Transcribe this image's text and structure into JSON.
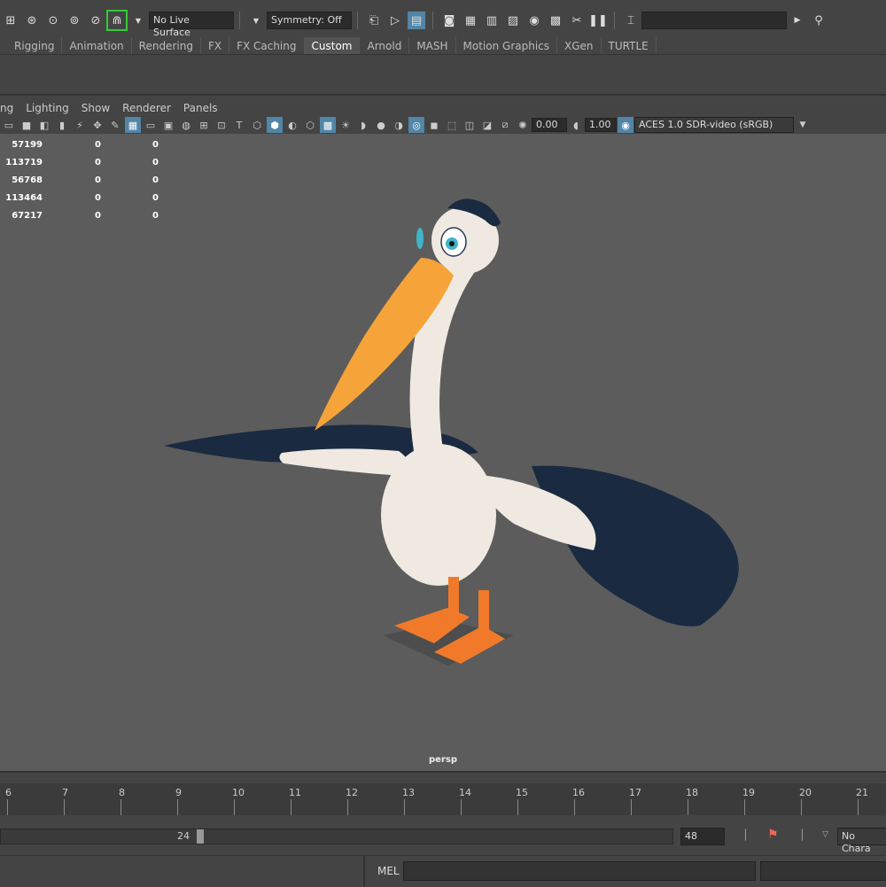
{
  "statusline": {
    "live_surface": "No Live Surface",
    "symmetry": "Symmetry: Off"
  },
  "shelf_tabs": [
    {
      "label": "Rigging",
      "active": false
    },
    {
      "label": "Animation",
      "active": false
    },
    {
      "label": "Rendering",
      "active": false
    },
    {
      "label": "FX",
      "active": false
    },
    {
      "label": "FX Caching",
      "active": false
    },
    {
      "label": "Custom",
      "active": true
    },
    {
      "label": "Arnold",
      "active": false
    },
    {
      "label": "MASH",
      "active": false
    },
    {
      "label": "Motion Graphics",
      "active": false
    },
    {
      "label": "XGen",
      "active": false
    },
    {
      "label": "TURTLE",
      "active": false
    }
  ],
  "panel_menu": {
    "partial_first": "ng",
    "items": [
      "Lighting",
      "Show",
      "Renderer",
      "Panels"
    ]
  },
  "panel_toolbar": {
    "exposure": "0.00",
    "gamma": "1.00",
    "color_space": "ACES 1.0 SDR-video (sRGB)"
  },
  "hud_rows": [
    [
      "57199",
      "0",
      "0"
    ],
    [
      "113719",
      "0",
      "0"
    ],
    [
      "56768",
      "0",
      "0"
    ],
    [
      "113464",
      "0",
      "0"
    ],
    [
      "67217",
      "0",
      "0"
    ]
  ],
  "viewport": {
    "camera": "persp",
    "colors": {
      "background": "#5c5c5c",
      "body": "#efe9e2",
      "beak": "#f6a43a",
      "feet": "#f07a2a",
      "wing_dark": "#1a2a40",
      "eye": "#3fb5c9"
    }
  },
  "timeline": {
    "ticks": [
      "6",
      "7",
      "8",
      "9",
      "10",
      "11",
      "12",
      "13",
      "14",
      "15",
      "16",
      "17",
      "18",
      "19",
      "20",
      "21"
    ]
  },
  "range": {
    "start_value": "24",
    "end_value": "48",
    "character_set": "No Chara"
  },
  "command_line": {
    "label": "MEL"
  }
}
